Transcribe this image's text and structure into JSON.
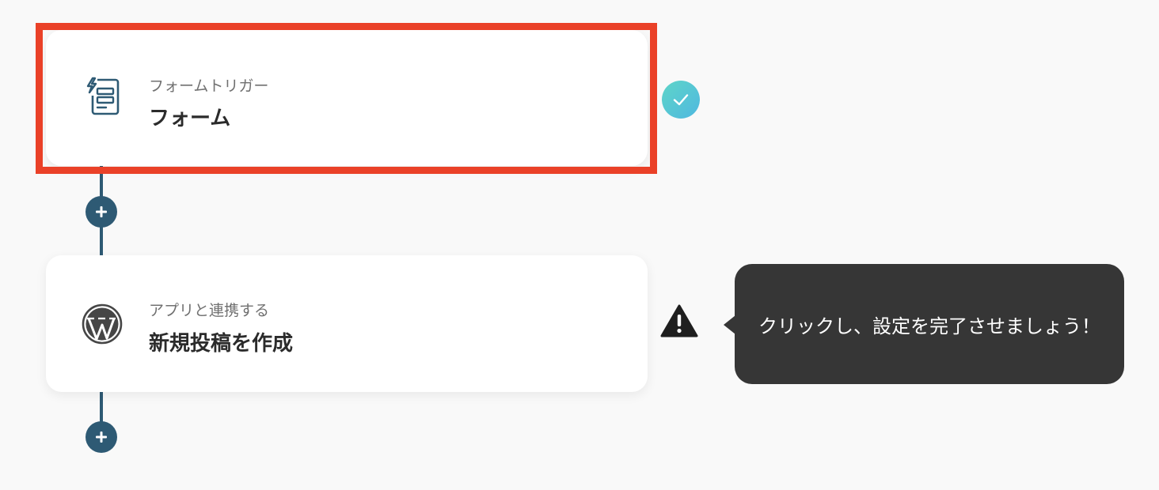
{
  "flow": {
    "steps": [
      {
        "subtitle": "フォームトリガー",
        "title": "フォーム",
        "icon": "form-trigger-icon",
        "status": "complete",
        "status_icon": "check-circle-icon"
      },
      {
        "subtitle": "アプリと連携する",
        "title": "新規投稿を作成",
        "icon": "wordpress-icon",
        "status": "warning",
        "status_icon": "warning-icon"
      }
    ],
    "add_step_label": "+"
  },
  "tooltip": {
    "text": "クリックし、設定を完了させましょう！"
  },
  "colors": {
    "background": "#f9f9f9",
    "connector": "#2e5a74",
    "highlight": "#ea4128",
    "tooltip_bg": "#363636",
    "check_gradient_start": "#5ed5c8",
    "check_gradient_end": "#4fb8e0"
  }
}
